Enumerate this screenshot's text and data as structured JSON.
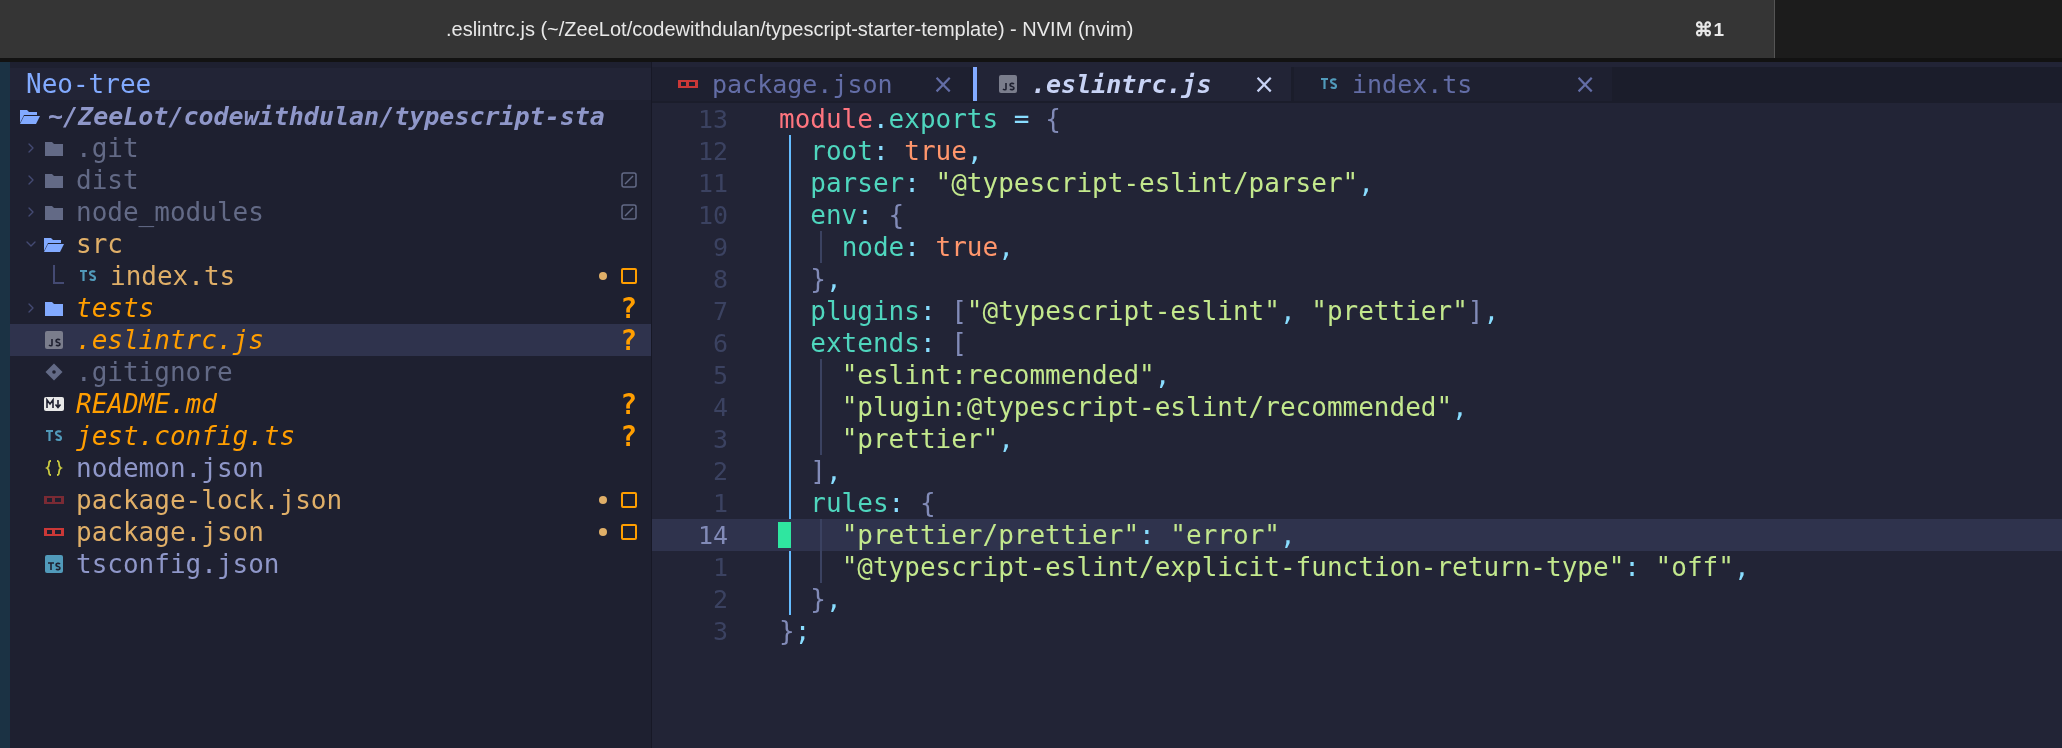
{
  "window": {
    "title": ".eslintrc.js (~/ZeeLot/codewithdulan/typescript-starter-template) - NVIM (nvim)",
    "shortcut": "⌘1"
  },
  "sidebar": {
    "title": "Neo-tree",
    "root": "~/ZeeLot/codewithdulan/typescript-sta",
    "items": [
      {
        "name": ".git",
        "kind": "folder",
        "expanded": false,
        "color": "#636a86",
        "git_ignored": false,
        "git_modified": false,
        "selected": false
      },
      {
        "name": "dist",
        "kind": "folder",
        "expanded": false,
        "color": "#636a86",
        "git_ignored": true,
        "git_modified": false,
        "selected": false
      },
      {
        "name": "node_modules",
        "kind": "folder",
        "expanded": false,
        "color": "#636a86",
        "git_ignored": true,
        "git_modified": false,
        "selected": false
      },
      {
        "name": "src",
        "kind": "folder",
        "expanded": true,
        "color": "#e0af68",
        "git_ignored": false,
        "git_modified": false,
        "selected": false,
        "children": [
          {
            "name": "index.ts",
            "kind": "ts",
            "color": "#e0af68",
            "git_ignored": false,
            "git_modified": true,
            "selected": false
          }
        ]
      },
      {
        "name": "tests",
        "kind": "folder",
        "expanded": false,
        "color": "#ff9e00",
        "badge": "?",
        "git_ignored": false,
        "git_modified": false,
        "selected": false
      },
      {
        "name": ".eslintrc.js",
        "kind": "js",
        "color": "#ff9e00",
        "badge": "?",
        "git_ignored": false,
        "git_modified": false,
        "selected": true
      },
      {
        "name": ".gitignore",
        "kind": "git",
        "color": "#636a86",
        "git_ignored": false,
        "git_modified": false,
        "selected": false
      },
      {
        "name": "README.md",
        "kind": "markdown",
        "color": "#ff9e00",
        "badge": "?",
        "git_ignored": false,
        "git_modified": false,
        "selected": false
      },
      {
        "name": "jest.config.ts",
        "kind": "ts",
        "color": "#ff9e00",
        "badge": "?",
        "git_ignored": false,
        "git_modified": false,
        "selected": false
      },
      {
        "name": "nodemon.json",
        "kind": "json",
        "color": "#8f97c9",
        "git_ignored": false,
        "git_modified": false,
        "selected": false
      },
      {
        "name": "package-lock.json",
        "kind": "npm-lock",
        "color": "#e0af68",
        "git_ignored": false,
        "git_modified": true,
        "selected": false
      },
      {
        "name": "package.json",
        "kind": "npm",
        "color": "#e0af68",
        "git_ignored": false,
        "git_modified": true,
        "selected": false
      },
      {
        "name": "tsconfig.json",
        "kind": "tsconfig",
        "color": "#8f97c9",
        "git_ignored": false,
        "git_modified": false,
        "selected": false
      }
    ]
  },
  "tabs": [
    {
      "label": "package.json",
      "kind": "npm",
      "close": "×",
      "selected": false
    },
    {
      "label": ".eslintrc.js",
      "kind": "js",
      "close": "×",
      "selected": true
    },
    {
      "label": "index.ts",
      "kind": "ts",
      "close": "×",
      "selected": false
    }
  ],
  "editor": {
    "lines": [
      {
        "number": "13",
        "current": false,
        "tokens": [
          {
            "kind": "keyword",
            "text": "module"
          },
          {
            "kind": "punct",
            "text": "."
          },
          {
            "kind": "prop",
            "text": "exports"
          },
          {
            "kind": "punct",
            "text": " = "
          },
          {
            "kind": "bracket",
            "text": "{"
          }
        ]
      },
      {
        "number": "12",
        "current": false,
        "tokens": [
          {
            "kind": "prop",
            "text": "  root"
          },
          {
            "kind": "punct",
            "text": ": "
          },
          {
            "kind": "bool",
            "text": "true"
          },
          {
            "kind": "punct",
            "text": ","
          }
        ]
      },
      {
        "number": "11",
        "current": false,
        "tokens": [
          {
            "kind": "prop",
            "text": "  parser"
          },
          {
            "kind": "punct",
            "text": ": "
          },
          {
            "kind": "string",
            "text": "\"@typescript-eslint/parser\""
          },
          {
            "kind": "punct",
            "text": ","
          }
        ]
      },
      {
        "number": "10",
        "current": false,
        "tokens": [
          {
            "kind": "prop",
            "text": "  env"
          },
          {
            "kind": "punct",
            "text": ": "
          },
          {
            "kind": "bracket",
            "text": "{"
          }
        ]
      },
      {
        "number": "9",
        "current": false,
        "tokens": [
          {
            "kind": "prop",
            "text": "    node"
          },
          {
            "kind": "punct",
            "text": ": "
          },
          {
            "kind": "bool",
            "text": "true"
          },
          {
            "kind": "punct",
            "text": ","
          }
        ]
      },
      {
        "number": "8",
        "current": false,
        "tokens": [
          {
            "kind": "bracket",
            "text": "  }"
          },
          {
            "kind": "punct",
            "text": ","
          }
        ]
      },
      {
        "number": "7",
        "current": false,
        "tokens": [
          {
            "kind": "prop",
            "text": "  plugins"
          },
          {
            "kind": "punct",
            "text": ": "
          },
          {
            "kind": "bracket",
            "text": "["
          },
          {
            "kind": "string",
            "text": "\"@typescript-eslint\""
          },
          {
            "kind": "punct",
            "text": ", "
          },
          {
            "kind": "string",
            "text": "\"prettier\""
          },
          {
            "kind": "bracket",
            "text": "]"
          },
          {
            "kind": "punct",
            "text": ","
          }
        ]
      },
      {
        "number": "6",
        "current": false,
        "tokens": [
          {
            "kind": "prop",
            "text": "  extends"
          },
          {
            "kind": "punct",
            "text": ": "
          },
          {
            "kind": "bracket",
            "text": "["
          }
        ]
      },
      {
        "number": "5",
        "current": false,
        "tokens": [
          {
            "kind": "string",
            "text": "    \"eslint:recommended\""
          },
          {
            "kind": "punct",
            "text": ","
          }
        ]
      },
      {
        "number": "4",
        "current": false,
        "tokens": [
          {
            "kind": "string",
            "text": "    \"plugin:@typescript-eslint/recommended\""
          },
          {
            "kind": "punct",
            "text": ","
          }
        ]
      },
      {
        "number": "3",
        "current": false,
        "tokens": [
          {
            "kind": "string",
            "text": "    \"prettier\""
          },
          {
            "kind": "punct",
            "text": ","
          }
        ]
      },
      {
        "number": "2",
        "current": false,
        "tokens": [
          {
            "kind": "bracket",
            "text": "  ]"
          },
          {
            "kind": "punct",
            "text": ","
          }
        ]
      },
      {
        "number": "1",
        "current": false,
        "tokens": [
          {
            "kind": "prop",
            "text": "  rules"
          },
          {
            "kind": "punct",
            "text": ": "
          },
          {
            "kind": "bracket",
            "text": "{"
          }
        ]
      },
      {
        "number": "14",
        "current": true,
        "tokens": [
          {
            "kind": "string",
            "text": "    \"prettier/prettier\""
          },
          {
            "kind": "punct",
            "text": ": "
          },
          {
            "kind": "string",
            "text": "\"error\""
          },
          {
            "kind": "punct",
            "text": ","
          }
        ]
      },
      {
        "number": "1",
        "current": false,
        "tokens": [
          {
            "kind": "string",
            "text": "    \"@typescript-eslint/explicit-function-return-type\""
          },
          {
            "kind": "punct",
            "text": ": "
          },
          {
            "kind": "string",
            "text": "\"off\""
          },
          {
            "kind": "punct",
            "text": ","
          }
        ]
      },
      {
        "number": "2",
        "current": false,
        "tokens": [
          {
            "kind": "bracket",
            "text": "  }"
          },
          {
            "kind": "punct",
            "text": ","
          }
        ]
      },
      {
        "number": "3",
        "current": false,
        "tokens": [
          {
            "kind": "bracket",
            "text": "}"
          },
          {
            "kind": "punct",
            "text": ";"
          }
        ]
      }
    ]
  }
}
